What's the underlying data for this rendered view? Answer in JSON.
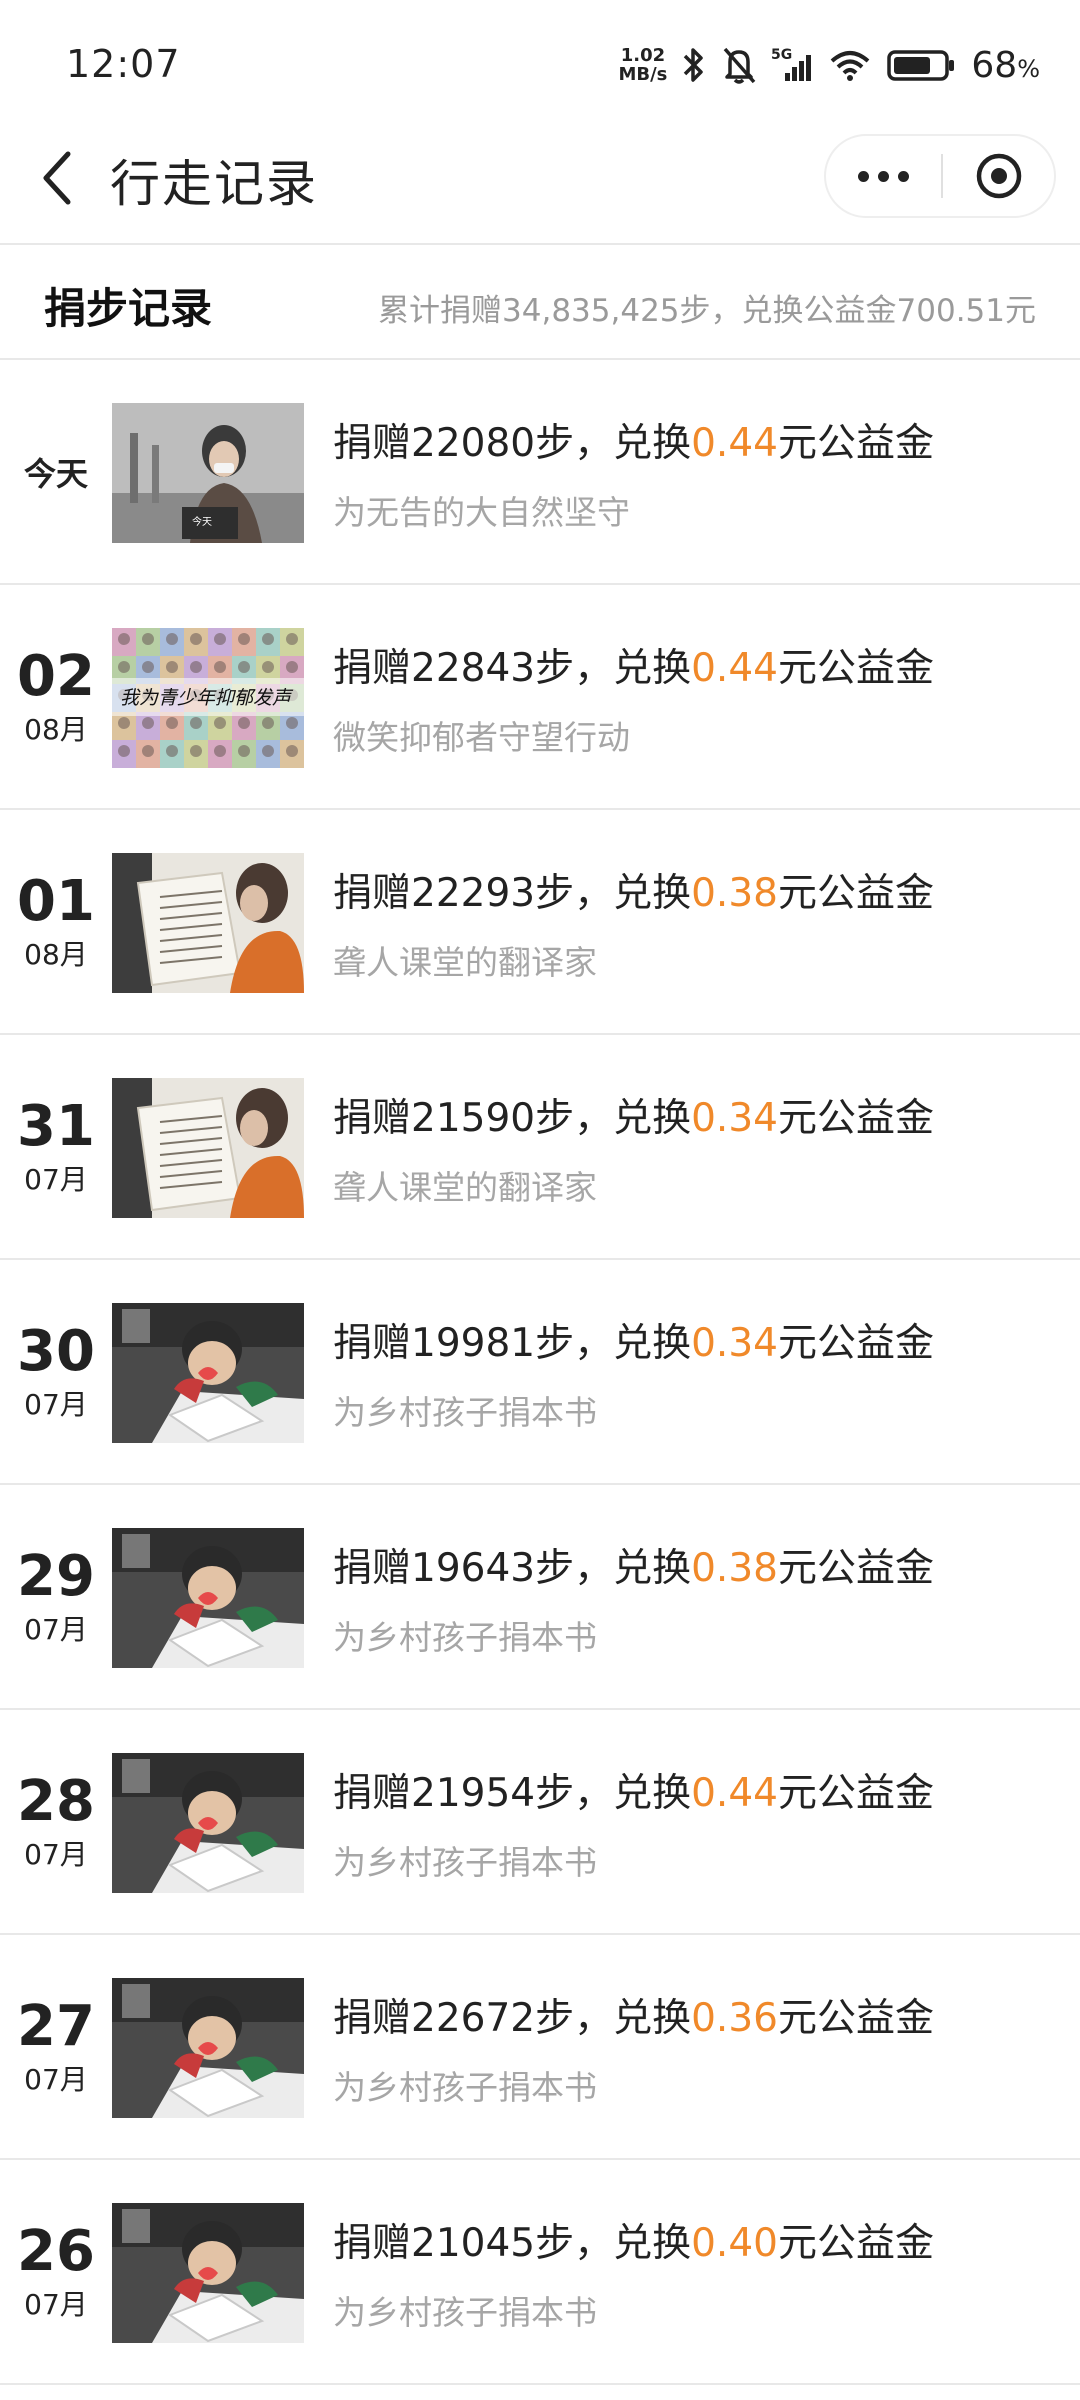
{
  "status_bar": {
    "time": "12:07",
    "net_speed_value": "1.02",
    "net_speed_unit": "MB/s",
    "network": "5G",
    "battery": "68",
    "battery_unit": "%"
  },
  "nav": {
    "title": "行走记录"
  },
  "summary": {
    "title": "捐步记录",
    "total": "累计捐赠34,835,425步，兑换公益金700.51元"
  },
  "text_parts": {
    "prefix": "捐赠",
    "steps_suffix": "步，兑换",
    "money_suffix": "元公益金"
  },
  "records": [
    {
      "day": "",
      "month": "",
      "today": "今天",
      "steps": "22080",
      "amount": "0.44",
      "project": "为无告的大自然坚守",
      "thumb_text": "今天",
      "thumb": "forest"
    },
    {
      "day": "02",
      "month": "08月",
      "today": "",
      "steps": "22843",
      "amount": "0.44",
      "project": "微笑抑郁者守望行动",
      "thumb_text": "我为青少年抑郁发声",
      "thumb": "smile"
    },
    {
      "day": "01",
      "month": "08月",
      "today": "",
      "steps": "22293",
      "amount": "0.38",
      "project": "聋人课堂的翻译家",
      "thumb_text": "",
      "thumb": "deaf"
    },
    {
      "day": "31",
      "month": "07月",
      "today": "",
      "steps": "21590",
      "amount": "0.34",
      "project": "聋人课堂的翻译家",
      "thumb_text": "",
      "thumb": "deaf"
    },
    {
      "day": "30",
      "month": "07月",
      "today": "",
      "steps": "19981",
      "amount": "0.34",
      "project": "为乡村孩子捐本书",
      "thumb_text": "",
      "thumb": "book"
    },
    {
      "day": "29",
      "month": "07月",
      "today": "",
      "steps": "19643",
      "amount": "0.38",
      "project": "为乡村孩子捐本书",
      "thumb_text": "",
      "thumb": "book"
    },
    {
      "day": "28",
      "month": "07月",
      "today": "",
      "steps": "21954",
      "amount": "0.44",
      "project": "为乡村孩子捐本书",
      "thumb_text": "",
      "thumb": "book"
    },
    {
      "day": "27",
      "month": "07月",
      "today": "",
      "steps": "22672",
      "amount": "0.36",
      "project": "为乡村孩子捐本书",
      "thumb_text": "",
      "thumb": "book"
    },
    {
      "day": "26",
      "month": "07月",
      "today": "",
      "steps": "21045",
      "amount": "0.40",
      "project": "为乡村孩子捐本书",
      "thumb_text": "",
      "thumb": "book"
    }
  ],
  "colors": {
    "accent": "#f0892a",
    "secondary_text": "#a6a6a6",
    "divider": "#e8e8e8"
  }
}
